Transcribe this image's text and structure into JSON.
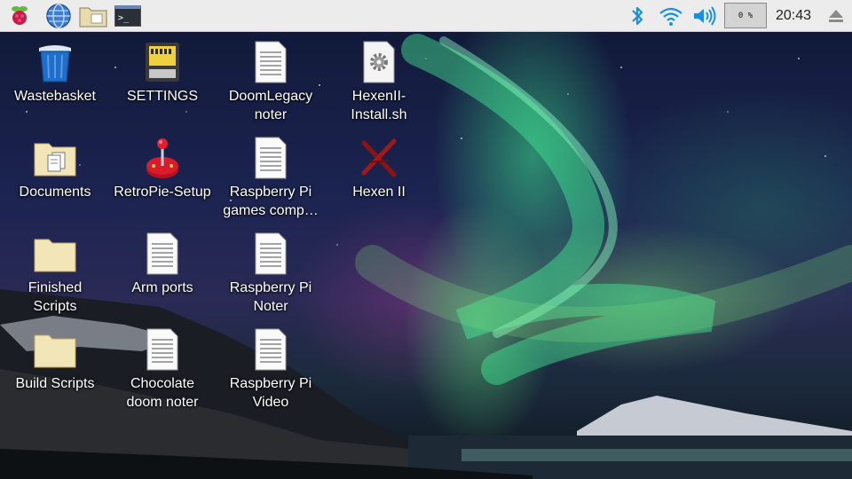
{
  "taskbar": {
    "launchers": [
      {
        "name": "raspberry-menu-icon"
      },
      {
        "name": "web-browser-icon"
      },
      {
        "name": "file-manager-icon"
      },
      {
        "name": "terminal-icon"
      }
    ],
    "terminal_prompt": ">_",
    "tray": {
      "bluetooth": "bluetooth-icon",
      "wifi": "wifi-icon",
      "volume": "volume-icon",
      "cpu_usage": "0 %",
      "clock": "20:43",
      "eject": "eject-icon"
    }
  },
  "desktop": {
    "icons": [
      {
        "label": "Wastebasket",
        "icon": "trash-icon"
      },
      {
        "label": "SETTINGS",
        "icon": "sd-card-icon"
      },
      {
        "label": "DoomLegacy noter",
        "icon": "text-file-icon"
      },
      {
        "label": "HexenII-Install.sh",
        "icon": "script-file-icon"
      },
      {
        "label": "Documents",
        "icon": "folder-documents-icon"
      },
      {
        "label": "RetroPie-Setup",
        "icon": "joystick-icon"
      },
      {
        "label": "Raspberry Pi games comp…",
        "icon": "text-file-icon"
      },
      {
        "label": "Hexen II",
        "icon": "hexen-x-icon"
      },
      {
        "label": "Finished Scripts",
        "icon": "folder-icon"
      },
      {
        "label": "Arm ports",
        "icon": "text-file-icon"
      },
      {
        "label": "Raspberry Pi Noter",
        "icon": "text-file-icon"
      },
      {
        "label": "Build Scripts",
        "icon": "folder-icon"
      },
      {
        "label": "Chocolate doom noter",
        "icon": "text-file-icon"
      },
      {
        "label": "Raspberry Pi Video",
        "icon": "text-file-icon"
      }
    ]
  },
  "colors": {
    "taskbar_bg": "#ececec",
    "tray_blue": "#1a8fe0",
    "aurora_green": "#3ce68c",
    "label_text": "#ffffff"
  }
}
